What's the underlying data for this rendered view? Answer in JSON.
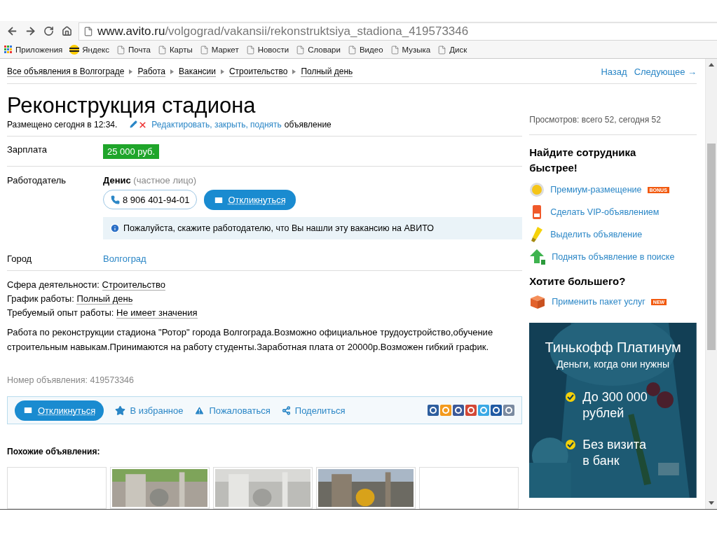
{
  "browser": {
    "address": {
      "host": "www.avito.ru",
      "path": "/volgograd/vakansii/rekonstruktsiya_stadiona_419573346"
    },
    "bookmarks": [
      {
        "kind": "apps",
        "label": "Приложения"
      },
      {
        "kind": "yandex",
        "label": "Яндекс"
      },
      {
        "kind": "page",
        "label": "Почта"
      },
      {
        "kind": "page",
        "label": "Карты"
      },
      {
        "kind": "page",
        "label": "Маркет"
      },
      {
        "kind": "page",
        "label": "Новости"
      },
      {
        "kind": "page",
        "label": "Словари"
      },
      {
        "kind": "page",
        "label": "Видео"
      },
      {
        "kind": "page",
        "label": "Музыка"
      },
      {
        "kind": "page",
        "label": "Диск"
      }
    ]
  },
  "breadcrumbs": [
    "Все объявления в Волгограде",
    "Работа",
    "Вакансии",
    "Строительство",
    "Полный день"
  ],
  "nav": {
    "back": "Назад",
    "next": "Следующее →"
  },
  "title": "Реконструкция стадиона",
  "posted": "Размещено сегодня в 12:34.",
  "manage_link": "Редактировать, закрыть, поднять",
  "manage_suffix": "объявление",
  "views": "Просмотров: всего 52, сегодня 52",
  "params": [
    {
      "kind": "salary",
      "label": "Зарплата",
      "value": "25 000 руб."
    },
    {
      "kind": "employer",
      "label": "Работодатель",
      "name": "Денис",
      "note": "(частное лицо)",
      "phone": "8 906 401-94-01",
      "reply": "Откликнуться",
      "hint": "Пожалуйста, скажите работодателю, что Вы нашли эту вакансию на АВИТО"
    },
    {
      "kind": "link",
      "label": "Город",
      "value": "Волгоград"
    }
  ],
  "details": [
    {
      "label": "Сфера деятельности:",
      "value": "Строительство"
    },
    {
      "label": "График работы:",
      "value": "Полный день"
    },
    {
      "label": "Требуемый опыт работы:",
      "value": "Не имеет значения"
    }
  ],
  "description": "Работа по реконструкции стадиона \"Ротор\" города Волгограда.Возможно официальное трудоустройство,обучение строительным навыкам.Принимаются на работу студенты.Заработная плата от 20000р.Возможен гибкий график.",
  "ad_number": "Номер объявления: 419573346",
  "actions": [
    {
      "kind": "primary",
      "label": "Откликнуться"
    },
    {
      "kind": "star",
      "label": "В избранное"
    },
    {
      "kind": "warning",
      "label": "Пожаловаться"
    },
    {
      "kind": "share",
      "label": "Поделиться"
    }
  ],
  "similar": {
    "title": "Похожие объявления:",
    "items": [
      {
        "kind": "blank"
      },
      {
        "kind": "picture"
      },
      {
        "kind": "picture"
      },
      {
        "kind": "picture"
      },
      {
        "kind": "blank"
      }
    ]
  },
  "promo": {
    "title": "Найдите сотрудника быстрее!",
    "items": [
      {
        "kind": "coin",
        "label": "Премиум-размещение",
        "badge": "BONUS"
      },
      {
        "kind": "vip",
        "label": "Сделать VIP-объявлением"
      },
      {
        "kind": "marker",
        "label": "Выделить объявление"
      },
      {
        "kind": "up",
        "label": "Поднять объявление в поиске"
      }
    ]
  },
  "more": {
    "title": "Хотите большего?",
    "items": [
      {
        "kind": "box",
        "label": "Применить пакет услуг",
        "badge": "NEW"
      }
    ]
  },
  "banner": {
    "title": "Тинькофф Платинум",
    "subtitle": "Деньги, когда они нужны",
    "points": [
      "До 300 000 рублей",
      "Без визита в банк"
    ]
  }
}
